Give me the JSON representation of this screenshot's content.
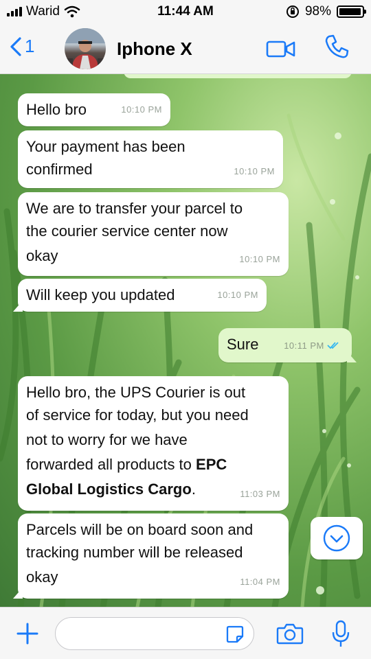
{
  "status_bar": {
    "carrier": "Warid",
    "time": "11:44 AM",
    "battery_text": "98%",
    "battery_level": 0.98,
    "icons": [
      "signal-icon",
      "wifi-icon",
      "orientation-lock-icon",
      "battery-icon"
    ]
  },
  "header": {
    "back_count": "1",
    "contact_name": "Iphone X",
    "icons": [
      "back-chevron-icon",
      "video-call-icon",
      "phone-call-icon"
    ]
  },
  "messages": [
    {
      "direction": "in",
      "text": "Hello bro",
      "time": "10:10 PM"
    },
    {
      "direction": "in",
      "text": "Your payment has been confirmed",
      "line1": "Your payment has been",
      "line2": "confirmed",
      "time": "10:10 PM"
    },
    {
      "direction": "in",
      "line1": "We are to transfer your parcel to",
      "line2": "the courier service center now",
      "line3": "okay",
      "time": "10:10 PM"
    },
    {
      "direction": "in",
      "text": "Will keep you updated",
      "time": "10:10 PM"
    },
    {
      "direction": "out",
      "text": "Sure",
      "time": "10:11 PM",
      "status": "read"
    },
    {
      "direction": "in",
      "line1": "Hello bro, the UPS Courier is out",
      "line2": "of service for today, but you need",
      "line3": "not to worry for we have",
      "line4_pre": "forwarded all products to ",
      "line4_bold": "EPC",
      "line5_bold": "Global Logistics Cargo",
      "line5_post": ".",
      "time": "11:03 PM"
    },
    {
      "direction": "in",
      "line1": "Parcels will be on board soon and",
      "line2": "tracking number will be released",
      "line3": "okay",
      "time": "11:04 PM"
    }
  ],
  "input_bar": {
    "placeholder": "",
    "icons": [
      "plus-icon",
      "sticker-icon",
      "camera-icon",
      "microphone-icon"
    ]
  },
  "colors": {
    "accent": "#1a7af8",
    "incoming_bubble": "#ffffff",
    "outgoing_bubble": "#e1f7cb",
    "read_ticks": "#34b7f1"
  }
}
